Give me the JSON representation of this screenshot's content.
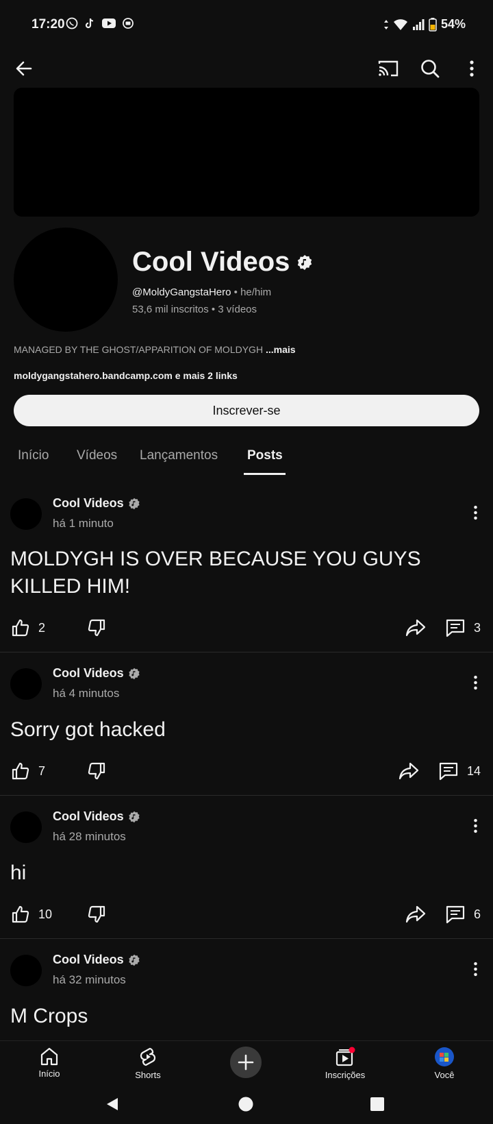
{
  "status_bar": {
    "time": "17:20",
    "battery": "54%",
    "app_icons": [
      "whatsapp-icon",
      "tiktok-icon",
      "youtube-icon",
      "radio-icon"
    ]
  },
  "channel": {
    "name": "Cool Videos",
    "handle": "@MoldyGangstaHero",
    "pronouns": "he/him",
    "subscribers": "53,6 mil inscritos",
    "videos": "3 vídeos",
    "description": "MANAGED BY THE GHOST/APPARITION OF MOLDYGH",
    "more_label": "...mais",
    "links": "moldygangstahero.bandcamp.com e mais 2 links",
    "subscribe_label": "Inscrever-se"
  },
  "tabs": [
    {
      "label": "Início",
      "active": false
    },
    {
      "label": "Vídeos",
      "active": false
    },
    {
      "label": "Lançamentos",
      "active": false
    },
    {
      "label": "Posts",
      "active": true
    }
  ],
  "posts": [
    {
      "author": "Cool Videos",
      "time": "há 1 minuto",
      "text": "MOLDYGH IS OVER BECAUSE YOU GUYS KILLED HIM!",
      "likes": "2",
      "comments": "3"
    },
    {
      "author": "Cool Videos",
      "time": "há 4 minutos",
      "text": "Sorry got hacked",
      "likes": "7",
      "comments": "14"
    },
    {
      "author": "Cool Videos",
      "time": "há 28 minutos",
      "text": "hi",
      "likes": "10",
      "comments": "6"
    },
    {
      "author": "Cool Videos",
      "time": "há 32 minutos",
      "text": "M Crops",
      "likes": "",
      "comments": ""
    }
  ],
  "bottom_nav": [
    {
      "label": "Início",
      "icon": "home-icon"
    },
    {
      "label": "Shorts",
      "icon": "shorts-icon"
    },
    {
      "label": "",
      "icon": "create-icon"
    },
    {
      "label": "Inscrições",
      "icon": "subscriptions-icon"
    },
    {
      "label": "Você",
      "icon": "account-avatar-icon"
    }
  ]
}
